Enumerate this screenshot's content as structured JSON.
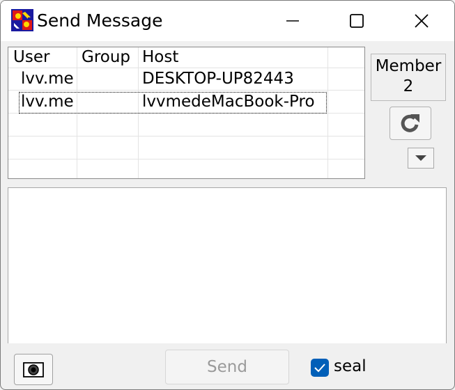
{
  "window": {
    "title": "Send Message"
  },
  "table": {
    "columns": [
      "User",
      "Group",
      "Host"
    ],
    "rows": [
      {
        "user": "lvv.me",
        "group": "",
        "host": "DESKTOP-UP82443"
      },
      {
        "user": "lvv.me",
        "group": "",
        "host": "lvvmedeMacBook-Pro"
      }
    ]
  },
  "member": {
    "label": "Member",
    "count": "2"
  },
  "message": {
    "value": ""
  },
  "footer": {
    "send_label": "Send",
    "send_enabled": false,
    "seal_label": "seal",
    "seal_checked": true
  },
  "icons": {
    "app": "app-icon",
    "refresh": "refresh-icon",
    "dropdown": "triangle-down-icon",
    "camera": "camera-icon",
    "minimize": "minimize-icon",
    "maximize": "maximize-icon",
    "close": "close-icon"
  },
  "colors": {
    "checkbox_accent": "#005fb8",
    "disabled_text": "#9a9a9a"
  }
}
